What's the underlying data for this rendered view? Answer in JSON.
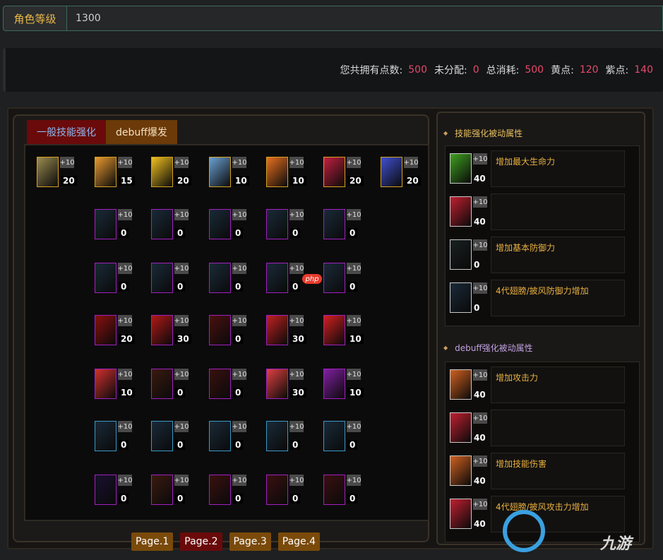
{
  "level": {
    "label": "角色等级",
    "value": "1300"
  },
  "points": {
    "total_label": "您共拥有点数:",
    "total": "500",
    "unassigned_label": "未分配:",
    "unassigned": "0",
    "consumed_label": "总消耗:",
    "consumed": "500",
    "yellow_label": "黄点:",
    "yellow": "120",
    "purple_label": "紫点:",
    "purple": "140"
  },
  "tabs": [
    {
      "label": "一般技能强化",
      "active": true
    },
    {
      "label": "debuff爆发",
      "active": false
    }
  ],
  "plus_label": "+10",
  "skill_grid": [
    {
      "row": 0,
      "cells": [
        {
          "value": "20",
          "style": "gold",
          "color": "#9a8a50"
        },
        {
          "value": "15",
          "style": "gold",
          "color": "#e89a30"
        },
        {
          "value": "20",
          "style": "gold",
          "color": "#f0c020"
        },
        {
          "value": "10",
          "style": "gold",
          "color": "#6aa0d0"
        },
        {
          "value": "10",
          "style": "gold",
          "color": "#e87020"
        },
        {
          "value": "20",
          "style": "gold",
          "color": "#c02040"
        },
        {
          "value": "20",
          "style": "gold",
          "color": "#4050d0"
        }
      ]
    },
    {
      "row": 1,
      "cells": [
        {
          "value": "0",
          "style": "purple",
          "color": "#1a2a38"
        },
        {
          "value": "0",
          "style": "purple",
          "color": "#1a2a38"
        },
        {
          "value": "0",
          "style": "purple",
          "color": "#1a2a38"
        },
        {
          "value": "0",
          "style": "purple",
          "color": "#1a2a38"
        },
        {
          "value": "0",
          "style": "purple",
          "color": "#1a2a38"
        }
      ]
    },
    {
      "row": 2,
      "cells": [
        {
          "value": "0",
          "style": "purple",
          "color": "#1a2a38"
        },
        {
          "value": "0",
          "style": "purple",
          "color": "#1a2a38"
        },
        {
          "value": "0",
          "style": "purple",
          "color": "#1a2a38"
        },
        {
          "value": "0",
          "style": "purple",
          "color": "#1a2a38"
        },
        {
          "value": "0",
          "style": "purple",
          "color": "#1a2a38"
        }
      ]
    },
    {
      "row": 3,
      "cells": [
        {
          "value": "20",
          "style": "purple",
          "color": "#8a1010"
        },
        {
          "value": "30",
          "style": "purple",
          "color": "#b01818"
        },
        {
          "value": "0",
          "style": "purple",
          "color": "#4a1010"
        },
        {
          "value": "30",
          "style": "purple",
          "color": "#c02020"
        },
        {
          "value": "10",
          "style": "purple",
          "color": "#d02020"
        }
      ]
    },
    {
      "row": 4,
      "cells": [
        {
          "value": "10",
          "style": "purple",
          "color": "#d03030"
        },
        {
          "value": "0",
          "style": "purple",
          "color": "#3a1a10"
        },
        {
          "value": "0",
          "style": "purple",
          "color": "#3a1010"
        },
        {
          "value": "30",
          "style": "purple",
          "color": "#e04040"
        },
        {
          "value": "10",
          "style": "purple",
          "color": "#8020a0"
        }
      ]
    },
    {
      "row": 5,
      "cells": [
        {
          "value": "0",
          "style": "blue",
          "color": "#1a2a38"
        },
        {
          "value": "0",
          "style": "blue",
          "color": "#1a2a38"
        },
        {
          "value": "0",
          "style": "blue",
          "color": "#1a2a38"
        },
        {
          "value": "0",
          "style": "blue",
          "color": "#1a2a38"
        },
        {
          "value": "0",
          "style": "blue",
          "color": "#1a2a38"
        }
      ]
    },
    {
      "row": 6,
      "cells": [
        {
          "value": "0",
          "style": "purple",
          "color": "#1a1030"
        },
        {
          "value": "0",
          "style": "purple",
          "color": "#3a1a10"
        },
        {
          "value": "0",
          "style": "purple",
          "color": "#3a1010"
        },
        {
          "value": "0",
          "style": "purple",
          "color": "#3a1010"
        },
        {
          "value": "0",
          "style": "purple",
          "color": "#3a1010"
        }
      ]
    }
  ],
  "pages": [
    "Page.1",
    "Page.2",
    "Page.3",
    "Page.4"
  ],
  "skill_section": {
    "title": "技能强化被动属性",
    "items": [
      {
        "value": "40",
        "desc": "增加最大生命力",
        "color": "#40a020"
      },
      {
        "value": "40",
        "desc": "",
        "color": "#c02030"
      },
      {
        "value": "0",
        "desc": "增加基本防御力",
        "color": "#1a2020"
      },
      {
        "value": "0",
        "desc": "4代翅膀/披风防御力增加",
        "color": "#1a2a38"
      }
    ]
  },
  "debuff_section": {
    "title": "debuff强化被动属性",
    "items": [
      {
        "value": "40",
        "desc": "增加攻击力",
        "color": "#d06020"
      },
      {
        "value": "40",
        "desc": "",
        "color": "#c02030"
      },
      {
        "value": "40",
        "desc": "增加技能伤害",
        "color": "#d06020"
      },
      {
        "value": "40",
        "desc": "4代翅膀/披风攻击力增加",
        "color": "#c02030"
      }
    ]
  },
  "watermarks": {
    "php": "php",
    "site": "九游"
  }
}
